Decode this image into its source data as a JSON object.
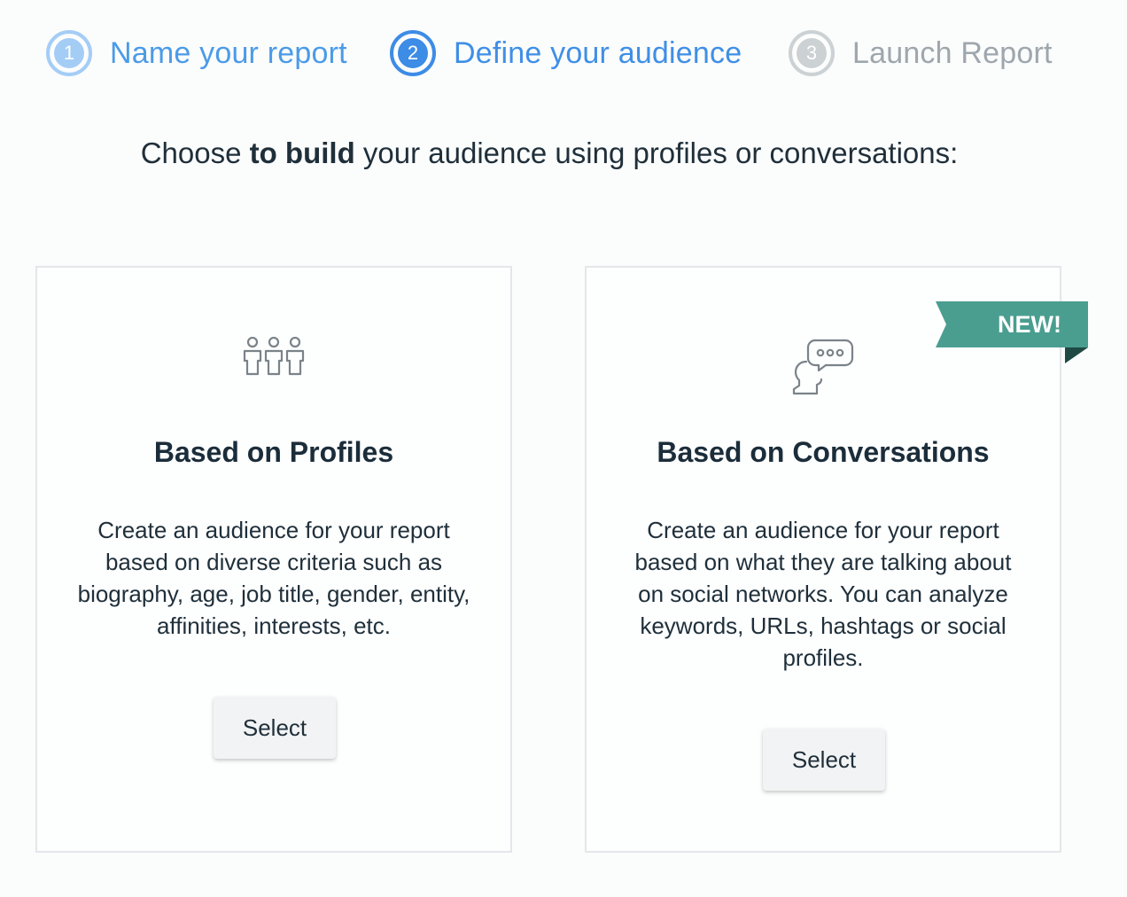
{
  "stepper": {
    "steps": [
      {
        "number": "1",
        "label": "Name your report",
        "state": "completed"
      },
      {
        "number": "2",
        "label": "Define your audience",
        "state": "active"
      },
      {
        "number": "3",
        "label": "Launch Report",
        "state": "upcoming"
      }
    ]
  },
  "heading": {
    "prefix": "Choose ",
    "bold": "to build",
    "suffix": " your audience using profiles or conversations:"
  },
  "cards": {
    "profiles": {
      "icon": "people-group-icon",
      "title": "Based on Profiles",
      "description": "Create an audience for your report based on diverse criteria such as biography, age, job title, gender, entity, affinities, interests, etc.",
      "button_label": "Select"
    },
    "conversations": {
      "icon": "speech-bubble-person-icon",
      "title": "Based on Conversations",
      "description": "Create an audience for your report based on what they are talking about on social networks. You can analyze keywords, URLs, hashtags or social profiles.",
      "button_label": "Select",
      "badge": "NEW!"
    }
  },
  "colors": {
    "step_completed": "#a4cdf6",
    "step_active": "#3d8ce6",
    "step_upcoming": "#ccd1d4",
    "badge": "#4a9e90",
    "badge_fold": "#1f4a44",
    "icon_stroke": "#7a8389"
  }
}
